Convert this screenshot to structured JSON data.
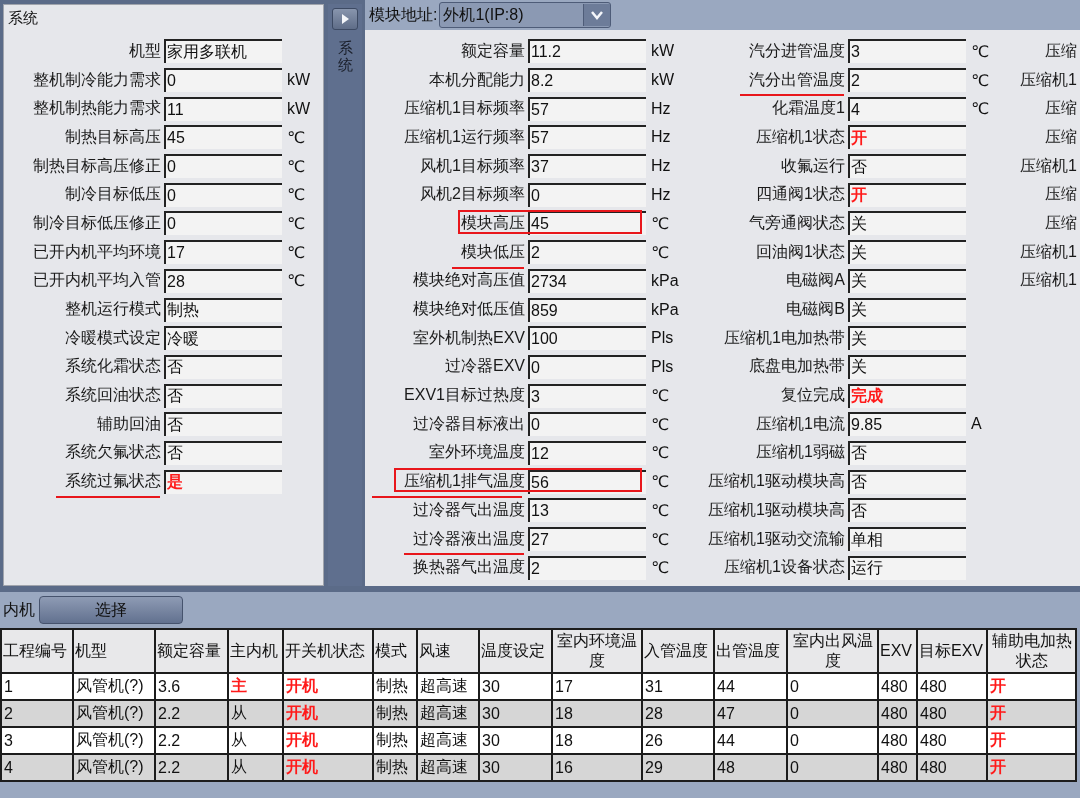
{
  "system_panel": {
    "title": "系统",
    "fields": [
      {
        "label": "机型",
        "value": "家用多联机",
        "alert": false
      },
      {
        "label": "整机制冷能力需求",
        "value": "0",
        "unit": "kW",
        "alert": false
      },
      {
        "label": "整机制热能力需求",
        "value": "11",
        "unit": "kW",
        "alert": false
      },
      {
        "label": "制热目标高压",
        "value": "45",
        "unit": "℃",
        "alert": false
      },
      {
        "label": "制热目标高压修正",
        "value": "0",
        "unit": "℃",
        "alert": false
      },
      {
        "label": "制冷目标低压",
        "value": "0",
        "unit": "℃",
        "alert": false
      },
      {
        "label": "制冷目标低压修正",
        "value": "0",
        "unit": "℃",
        "alert": false
      },
      {
        "label": "已开内机平均环境",
        "value": "17",
        "unit": "℃",
        "alert": false
      },
      {
        "label": "已开内机平均入管",
        "value": "28",
        "unit": "℃",
        "alert": false
      },
      {
        "label": "整机运行模式",
        "value": "制热",
        "alert": false
      },
      {
        "label": "冷暖模式设定",
        "value": "冷暖",
        "alert": false
      },
      {
        "label": "系统化霜状态",
        "value": "否",
        "alert": false
      },
      {
        "label": "系统回油状态",
        "value": "否",
        "alert": false
      },
      {
        "label": "辅助回油",
        "value": "否",
        "alert": false
      },
      {
        "label": "系统欠氟状态",
        "value": "否",
        "alert": false
      },
      {
        "label": "系统过氟状态",
        "value": "是",
        "alert": true,
        "underlined": true
      }
    ]
  },
  "side_tab": {
    "label": "系统"
  },
  "module": {
    "address_label": "模块地址:",
    "address_value": "外机1(IP:8)",
    "columns": [
      {
        "fields": [
          {
            "label": "额定容量",
            "value": "11.2",
            "unit": "kW",
            "alert": false
          },
          {
            "label": "本机分配能力",
            "value": "8.2",
            "unit": "kW",
            "alert": false
          },
          {
            "label": "压缩机1目标频率",
            "value": "57",
            "unit": "Hz",
            "alert": false
          },
          {
            "label": "压缩机1运行频率",
            "value": "57",
            "unit": "Hz",
            "alert": false
          },
          {
            "label": "风机1目标频率",
            "value": "37",
            "unit": "Hz",
            "alert": false
          },
          {
            "label": "风机2目标频率",
            "value": "0",
            "unit": "Hz",
            "alert": false
          },
          {
            "label": "模块高压",
            "value": "45",
            "unit": "℃",
            "alert": false,
            "boxed": true
          },
          {
            "label": "模块低压",
            "value": "2",
            "unit": "℃",
            "alert": false,
            "underlined": true
          },
          {
            "label": "模块绝对高压值",
            "value": "2734",
            "unit": "kPa",
            "alert": false
          },
          {
            "label": "模块绝对低压值",
            "value": "859",
            "unit": "kPa",
            "alert": false
          },
          {
            "label": "室外机制热EXV",
            "value": "100",
            "unit": "Pls",
            "alert": false
          },
          {
            "label": "过冷器EXV",
            "value": "0",
            "unit": "Pls",
            "alert": false
          },
          {
            "label": "EXV1目标过热度",
            "value": "3",
            "unit": "℃",
            "alert": false
          },
          {
            "label": "过冷器目标液出",
            "value": "0",
            "unit": "℃",
            "alert": false
          },
          {
            "label": "室外环境温度",
            "value": "12",
            "unit": "℃",
            "alert": false
          },
          {
            "label": "压缩机1排气温度",
            "value": "56",
            "unit": "℃",
            "alert": false,
            "boxed": true,
            "underlined": true
          },
          {
            "label": "过冷器气出温度",
            "value": "13",
            "unit": "℃",
            "alert": false
          },
          {
            "label": "过冷器液出温度",
            "value": "27",
            "unit": "℃",
            "alert": false,
            "underlined": true
          },
          {
            "label": "换热器气出温度",
            "value": "2",
            "unit": "℃",
            "alert": false
          }
        ]
      },
      {
        "fields": [
          {
            "label": "汽分进管温度",
            "value": "3",
            "unit": "℃",
            "alert": false
          },
          {
            "label": "汽分出管温度",
            "value": "2",
            "unit": "℃",
            "alert": false,
            "underlined": true
          },
          {
            "label": "化霜温度1",
            "value": "4",
            "unit": "℃",
            "alert": false
          },
          {
            "label": "压缩机1状态",
            "value": "开",
            "alert": true
          },
          {
            "label": "收氟运行",
            "value": "否",
            "alert": false
          },
          {
            "label": "四通阀1状态",
            "value": "开",
            "alert": true
          },
          {
            "label": "气旁通阀状态",
            "value": "关",
            "alert": false
          },
          {
            "label": "回油阀1状态",
            "value": "关",
            "alert": false
          },
          {
            "label": "电磁阀A",
            "value": "关",
            "alert": false
          },
          {
            "label": "电磁阀B",
            "value": "关",
            "alert": false
          },
          {
            "label": "压缩机1电加热带",
            "value": "关",
            "alert": false
          },
          {
            "label": "底盘电加热带",
            "value": "关",
            "alert": false
          },
          {
            "label": "复位完成",
            "value": "完成",
            "alert": true
          },
          {
            "label": "压缩机1电流",
            "value": "9.85",
            "unit": "A",
            "alert": false
          },
          {
            "label": "压缩机1弱磁",
            "value": "否",
            "alert": false
          },
          {
            "label": "压缩机1驱动模块高",
            "value": "否",
            "alert": false
          },
          {
            "label": "压缩机1驱动模块高",
            "value": "否",
            "alert": false
          },
          {
            "label": "压缩机1驱动交流输",
            "value": "单相",
            "alert": false
          },
          {
            "label": "压缩机1设备状态",
            "value": "运行",
            "alert": false
          }
        ]
      },
      {
        "fields": [
          {
            "label": "压缩"
          },
          {
            "label": "压缩机1"
          },
          {
            "label": "压缩"
          },
          {
            "label": "压缩"
          },
          {
            "label": "压缩机1"
          },
          {
            "label": "压缩"
          },
          {
            "label": "压缩"
          },
          {
            "label": "压缩机1"
          },
          {
            "label": "压缩机1"
          }
        ]
      }
    ]
  },
  "indoor": {
    "label": "内机",
    "button": "选择",
    "table": {
      "columns": [
        "工程编号",
        "机型",
        "额定容量",
        "主内机",
        "开关机状态",
        "模式",
        "风速",
        "温度设定",
        "室内环境温度",
        "入管温度",
        "出管温度",
        "室内出风温度",
        "EXV",
        "目标EXV",
        "辅助电加热状态"
      ],
      "rows": [
        {
          "cells": [
            {
              "text": "1",
              "alert": false
            },
            {
              "text": "风管机(?)",
              "alert": false
            },
            {
              "text": "3.6",
              "alert": false
            },
            {
              "text": "主",
              "alert": true
            },
            {
              "text": "开机",
              "alert": true
            },
            {
              "text": "制热",
              "alert": false
            },
            {
              "text": "超高速",
              "alert": false
            },
            {
              "text": "30",
              "alert": false
            },
            {
              "text": "17",
              "alert": false
            },
            {
              "text": "31",
              "alert": false
            },
            {
              "text": "44",
              "alert": false
            },
            {
              "text": "0",
              "alert": false
            },
            {
              "text": "480",
              "alert": false
            },
            {
              "text": "480",
              "alert": false
            },
            {
              "text": "开",
              "alert": true
            }
          ]
        },
        {
          "cells": [
            {
              "text": "2",
              "alert": false
            },
            {
              "text": "风管机(?)",
              "alert": false
            },
            {
              "text": "2.2",
              "alert": false
            },
            {
              "text": "从",
              "alert": false
            },
            {
              "text": "开机",
              "alert": true
            },
            {
              "text": "制热",
              "alert": false
            },
            {
              "text": "超高速",
              "alert": false
            },
            {
              "text": "30",
              "alert": false
            },
            {
              "text": "18",
              "alert": false
            },
            {
              "text": "28",
              "alert": false
            },
            {
              "text": "47",
              "alert": false
            },
            {
              "text": "0",
              "alert": false
            },
            {
              "text": "480",
              "alert": false
            },
            {
              "text": "480",
              "alert": false
            },
            {
              "text": "开",
              "alert": true
            }
          ]
        },
        {
          "cells": [
            {
              "text": "3",
              "alert": false
            },
            {
              "text": "风管机(?)",
              "alert": false
            },
            {
              "text": "2.2",
              "alert": false
            },
            {
              "text": "从",
              "alert": false
            },
            {
              "text": "开机",
              "alert": true
            },
            {
              "text": "制热",
              "alert": false
            },
            {
              "text": "超高速",
              "alert": false
            },
            {
              "text": "30",
              "alert": false
            },
            {
              "text": "18",
              "alert": false
            },
            {
              "text": "26",
              "alert": false
            },
            {
              "text": "44",
              "alert": false
            },
            {
              "text": "0",
              "alert": false
            },
            {
              "text": "480",
              "alert": false
            },
            {
              "text": "480",
              "alert": false
            },
            {
              "text": "开",
              "alert": true
            }
          ]
        },
        {
          "cells": [
            {
              "text": "4",
              "alert": false
            },
            {
              "text": "风管机(?)",
              "alert": false
            },
            {
              "text": "2.2",
              "alert": false
            },
            {
              "text": "从",
              "alert": false
            },
            {
              "text": "开机",
              "alert": true
            },
            {
              "text": "制热",
              "alert": false
            },
            {
              "text": "超高速",
              "alert": false
            },
            {
              "text": "30",
              "alert": false
            },
            {
              "text": "16",
              "alert": false
            },
            {
              "text": "29",
              "alert": false
            },
            {
              "text": "48",
              "alert": false
            },
            {
              "text": "0",
              "alert": false
            },
            {
              "text": "480",
              "alert": false
            },
            {
              "text": "480",
              "alert": false
            },
            {
              "text": "开",
              "alert": true
            }
          ]
        }
      ]
    }
  }
}
